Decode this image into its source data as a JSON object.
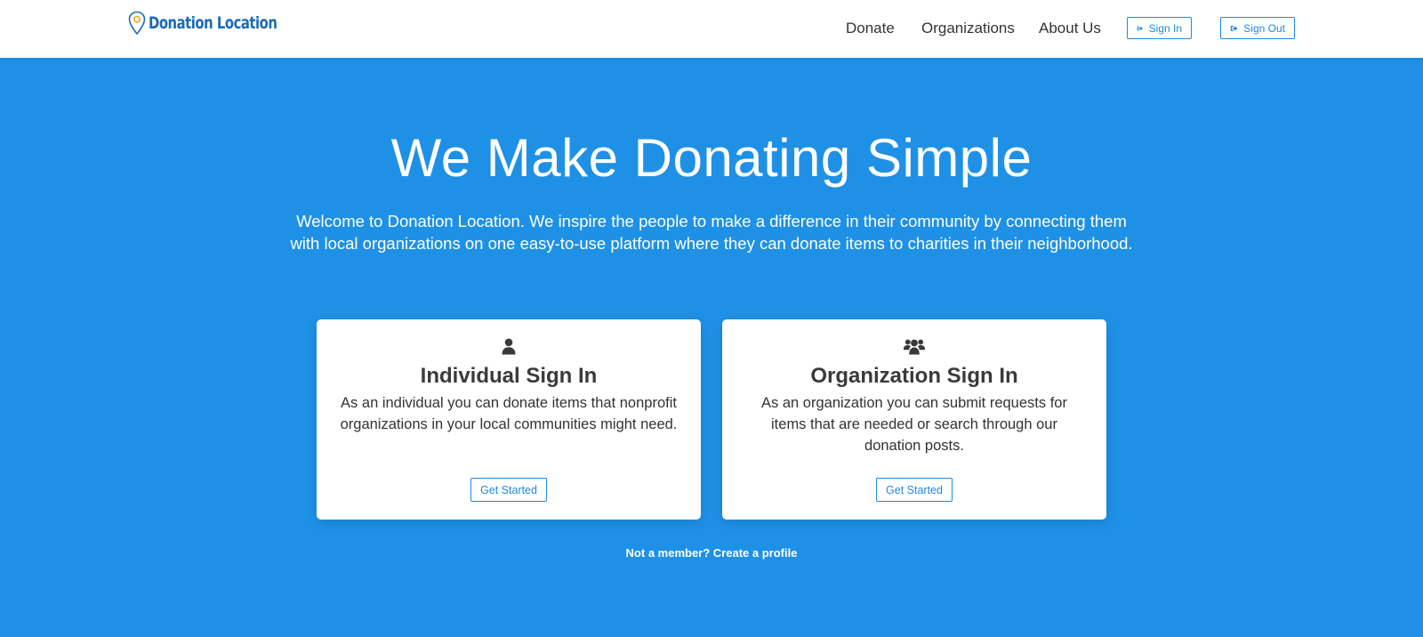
{
  "nav": {
    "brand": "Donation Location",
    "links": [
      "Donate",
      "Organizations",
      "About Us"
    ],
    "sign_in": "Sign In",
    "sign_out": "Sign Out"
  },
  "hero": {
    "title": "We Make Donating Simple",
    "subtitle": "Welcome to Donation Location. We inspire the people to make a difference in their community by connecting them with local organizations on one easy-to-use platform where they can donate items to charities in their neighborhood."
  },
  "cards": [
    {
      "icon": "user-icon",
      "title": "Individual Sign In",
      "text": "As an individual you can donate items that nonprofit organizations in your local communities might need.",
      "button": "Get Started"
    },
    {
      "icon": "users-icon",
      "title": "Organization Sign In",
      "text": "As an organization you can submit requests for items that are needed or search through our donation posts.",
      "button": "Get Started"
    }
  ],
  "signup_link": "Not a member? Create a profile",
  "colors": {
    "hero_background": "#1e91e6",
    "accent": "#1e88e5",
    "brand": "#1a6bb3",
    "pin_dot": "#f5a623"
  }
}
